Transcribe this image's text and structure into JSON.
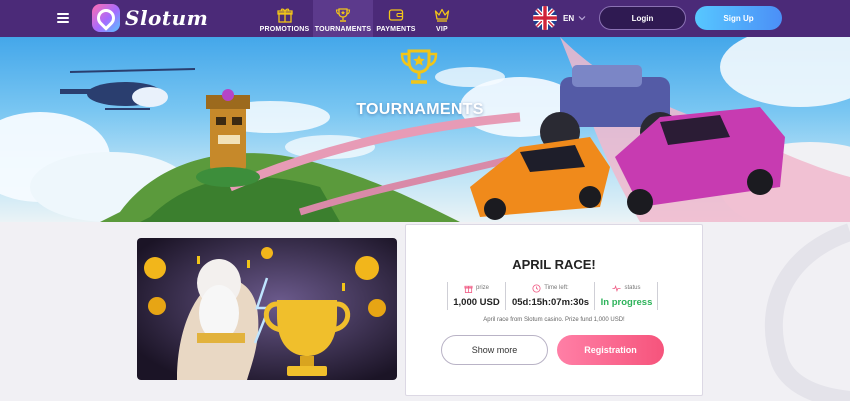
{
  "header": {
    "brand": "Slotum",
    "nav": [
      {
        "label": "PROMOTIONS",
        "icon": "gift-icon"
      },
      {
        "label": "TOURNAMENTS",
        "icon": "trophy-icon",
        "active": true
      },
      {
        "label": "PAYMENTS",
        "icon": "wallet-icon"
      },
      {
        "label": "VIP",
        "icon": "crown-icon"
      }
    ],
    "language": "EN",
    "login_label": "Login",
    "signup_label": "Sign Up"
  },
  "banner": {
    "title": "TOURNAMENTS"
  },
  "tournament": {
    "title": "APRIL RACE!",
    "prize_label": "prize",
    "prize_value": "1,000 USD",
    "time_label": "Time left:",
    "time_value": "05d:15h:07m:30s",
    "status_label": "status",
    "status_value": "In progress",
    "description": "April race from Slotum casino. Prize fund 1,000 USD!",
    "show_more_label": "Show more",
    "registration_label": "Registration"
  },
  "colors": {
    "header_bg": "#4b2a78",
    "signup_gradient": [
      "#57c7ff",
      "#4b8ff7"
    ],
    "registration_gradient": [
      "#ff7fa6",
      "#f6547c"
    ],
    "status_green": "#2db35a",
    "trophy_gold": "#f2c518"
  }
}
